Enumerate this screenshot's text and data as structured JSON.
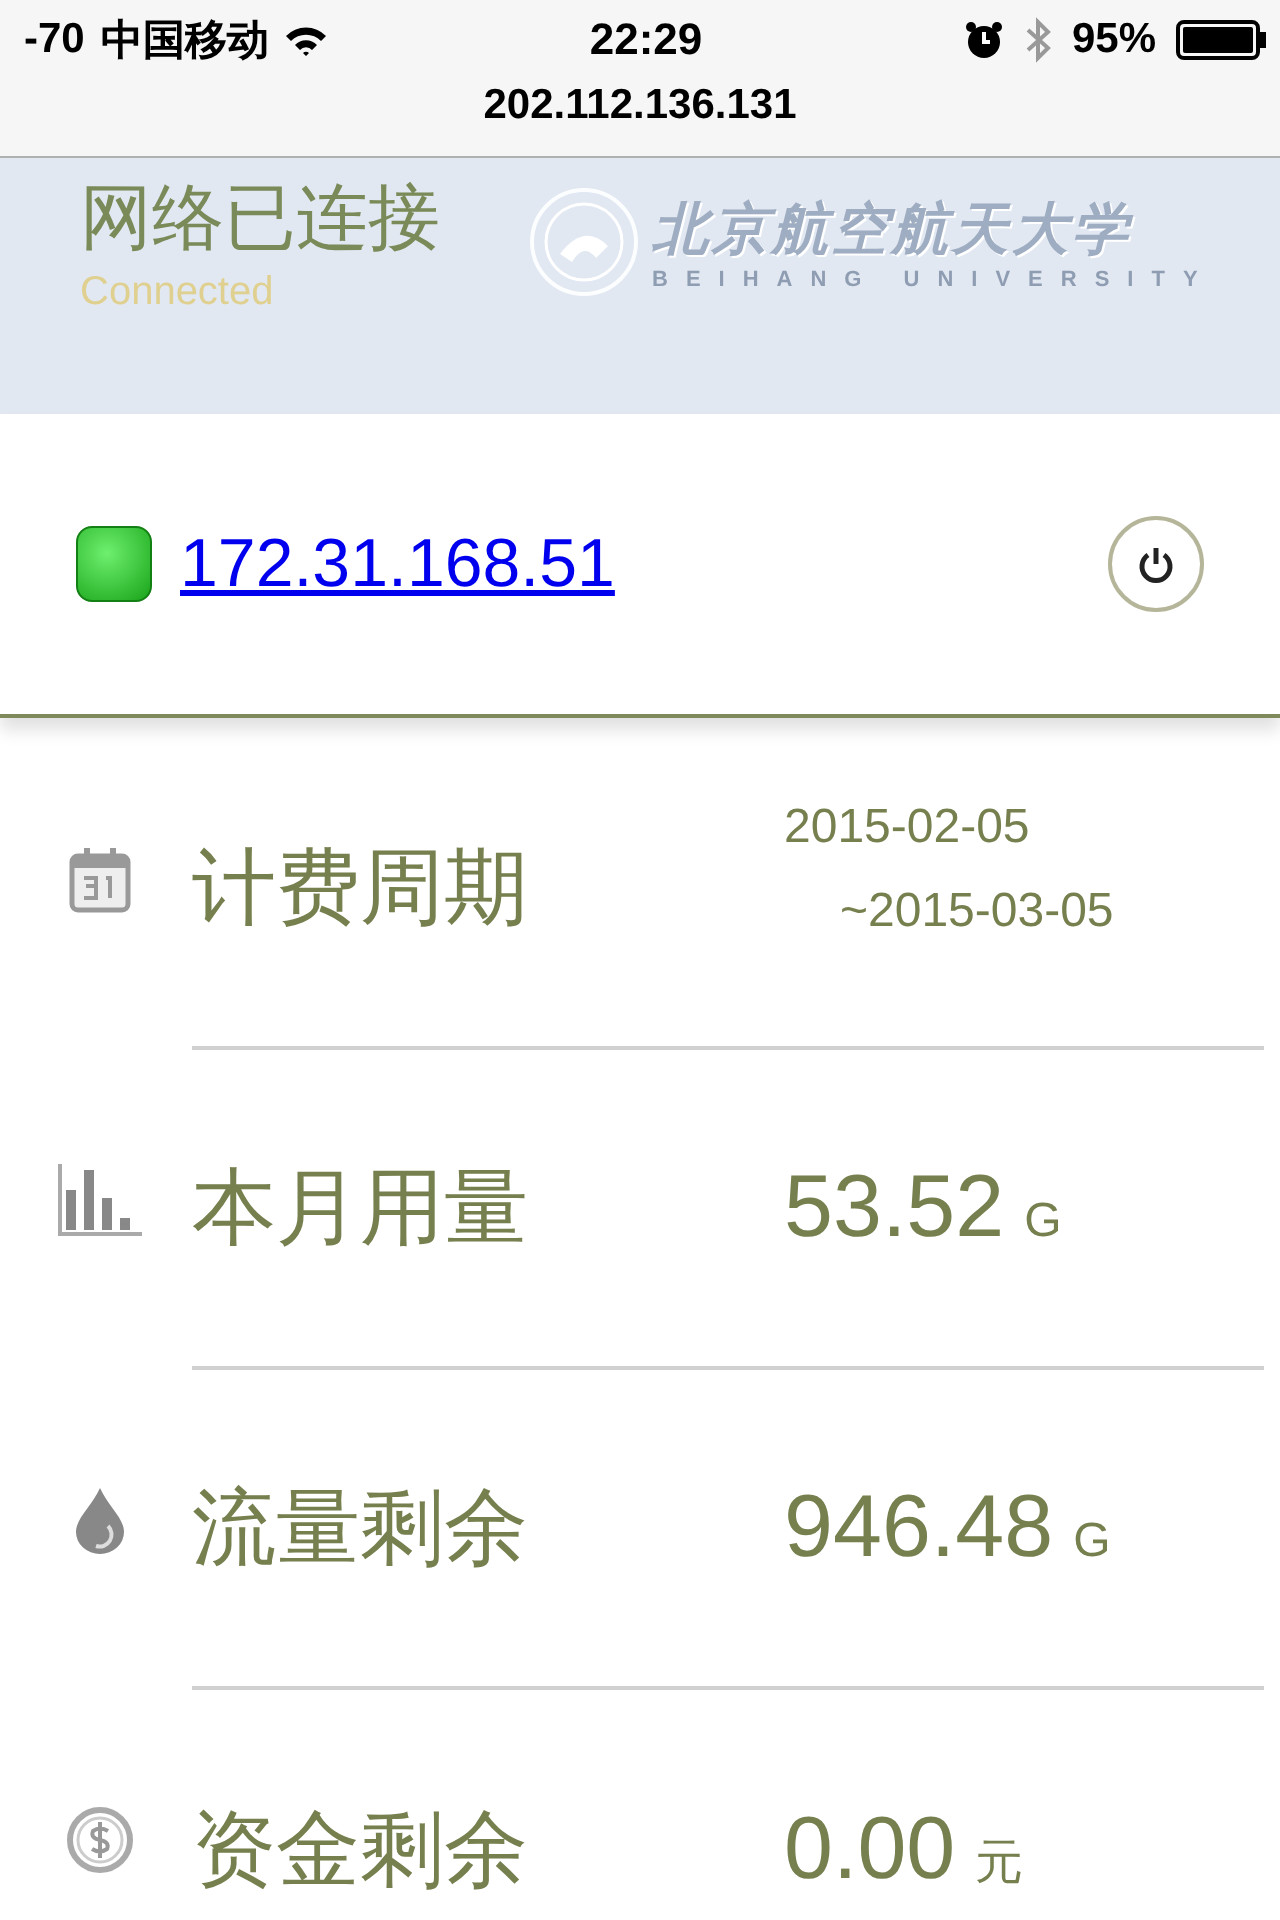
{
  "status_bar": {
    "signal": "-70",
    "carrier": "中国移动",
    "time": "22:29",
    "battery": "95%",
    "alarm": true,
    "bluetooth": true
  },
  "page_title": "202.112.136.131",
  "header": {
    "status": "网络已连接",
    "status_en": "Connected",
    "logo_name": "北京航空航天大学",
    "logo_sub": "BEIHANG UNIVERSITY"
  },
  "connection": {
    "ip": "172.31.168.51",
    "online": true
  },
  "stats": [
    {
      "kind": "period",
      "label": "计费周期",
      "start": "2015-02-05",
      "end": "~2015-03-05"
    },
    {
      "kind": "amount",
      "label": "本月用量",
      "value": "53.52",
      "unit": "G"
    },
    {
      "kind": "amount",
      "label": "流量剩余",
      "value": "946.48",
      "unit": "G"
    },
    {
      "kind": "amount",
      "label": "资金剩余",
      "value": "0.00",
      "unit": "元"
    }
  ]
}
